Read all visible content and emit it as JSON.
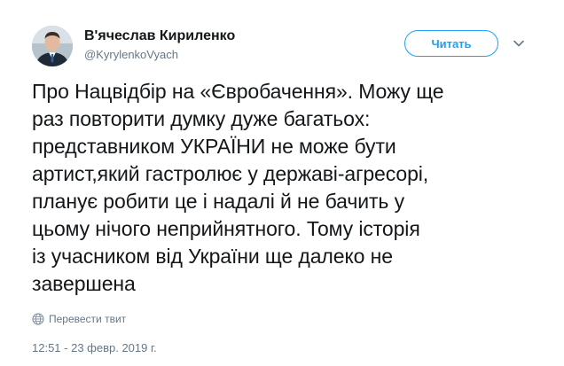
{
  "author": {
    "display_name": "В'ячеслав Кириленко",
    "handle": "@KyrylenkoVyach",
    "avatar_icon": "person-avatar"
  },
  "follow_button": {
    "label": "Читать",
    "color": "#1da1f2"
  },
  "menu_icon": "chevron-down-icon",
  "tweet": {
    "lines": [
      "Про Нацвідбір на «Євробачення». Можу ще",
      "раз повторити думку дуже багатьох:",
      "представником УКРАЇНИ не може бути",
      "артист,який гастролює у державі-агресорі,",
      "планує робити це і надалі й не бачить у",
      "цьому нічого неприйнятного. Тому історія",
      "із учасником від України ще далеко не",
      "завершена"
    ],
    "translate_label": "Перевести твит",
    "translate_icon": "globe-icon",
    "timestamp": "12:51 - 23 февр. 2019 г."
  }
}
